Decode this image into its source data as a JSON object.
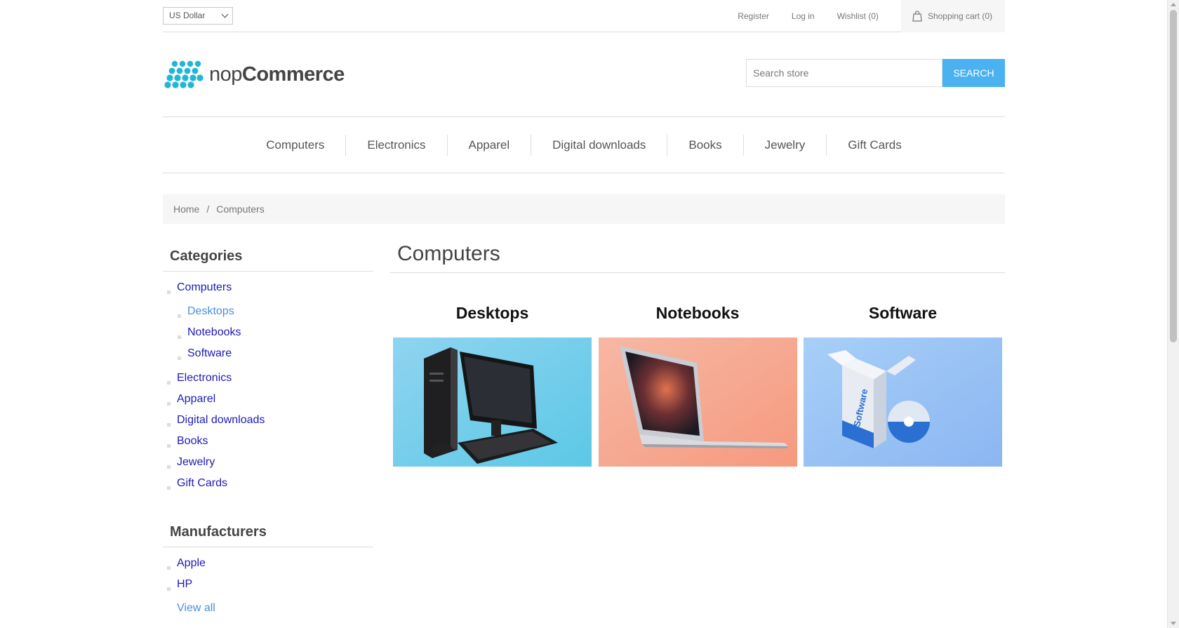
{
  "header": {
    "currency": "US Dollar",
    "links": {
      "register": "Register",
      "login": "Log in",
      "wishlist": "Wishlist (0)",
      "cart": "Shopping cart (0)"
    }
  },
  "logo": {
    "part1": "nop",
    "part2": "Commerce"
  },
  "search": {
    "placeholder": "Search store",
    "button": "SEARCH"
  },
  "menu": [
    "Computers",
    "Electronics",
    "Apparel",
    "Digital downloads",
    "Books",
    "Jewelry",
    "Gift Cards"
  ],
  "breadcrumb": {
    "home": "Home",
    "separator": "/",
    "current": "Computers"
  },
  "sidebar": {
    "categories_title": "Categories",
    "categories": {
      "computers": "Computers",
      "subs": [
        "Desktops",
        "Notebooks",
        "Software"
      ],
      "rest": [
        "Electronics",
        "Apparel",
        "Digital downloads",
        "Books",
        "Jewelry",
        "Gift Cards"
      ]
    },
    "manufacturers_title": "Manufacturers",
    "manufacturers": [
      "Apple",
      "HP"
    ],
    "view_all": "View all"
  },
  "main": {
    "title": "Computers",
    "subcategories": [
      {
        "name": "Desktops",
        "image": "desktop-computer-image"
      },
      {
        "name": "Notebooks",
        "image": "laptop-image"
      },
      {
        "name": "Software",
        "image": "software-box-image"
      }
    ]
  },
  "colors": {
    "accent": "#4ab2f1",
    "link": "#1d1bb5",
    "active_link": "#4a8fdd",
    "logo": "#21b5d6"
  }
}
